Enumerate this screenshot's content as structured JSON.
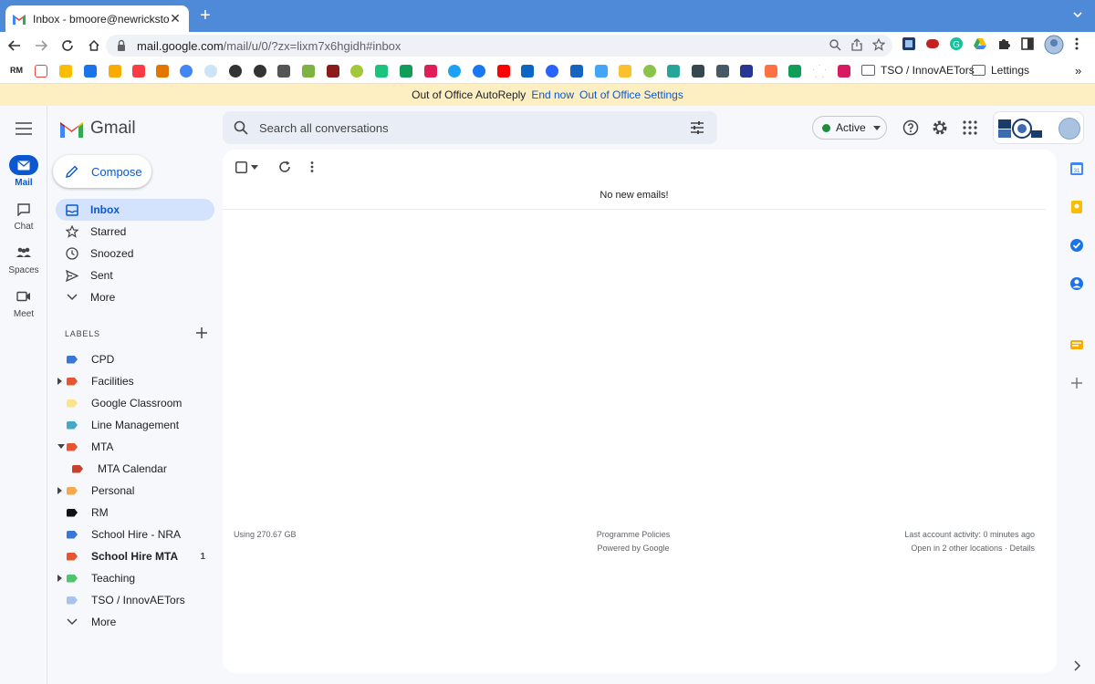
{
  "browser": {
    "tab_title": "Inbox - bmoore@newrickstone",
    "url_host": "mail.google.com",
    "url_path": "/mail/u/0/?zx=lixm7x6hgidh#inbox",
    "bookmark_folders": [
      "TSO / InnovAETors",
      "Lettings"
    ],
    "bookmark_prefix": "RM"
  },
  "ooo_banner": {
    "text": "Out of Office AutoReply",
    "end_now": "End now",
    "settings": "Out of Office Settings"
  },
  "rail": {
    "items": [
      {
        "label": "Mail"
      },
      {
        "label": "Chat"
      },
      {
        "label": "Spaces"
      },
      {
        "label": "Meet"
      }
    ]
  },
  "header": {
    "app_name": "Gmail",
    "search_placeholder": "Search all conversations",
    "status": "Active"
  },
  "compose_label": "Compose",
  "nav": {
    "items": [
      {
        "label": "Inbox"
      },
      {
        "label": "Starred"
      },
      {
        "label": "Snoozed"
      },
      {
        "label": "Sent"
      },
      {
        "label": "More"
      }
    ]
  },
  "labels": {
    "header": "LABELS",
    "items": [
      {
        "label": "CPD",
        "color": "#3a76d8"
      },
      {
        "label": "Facilities",
        "color": "#e8542d"
      },
      {
        "label": "Google Classroom",
        "color": "#fce48b"
      },
      {
        "label": "Line Management",
        "color": "#44a8c6"
      },
      {
        "label": "MTA",
        "color": "#e8542d"
      },
      {
        "label": "MTA Calendar",
        "color": "#c9412e"
      },
      {
        "label": "Personal",
        "color": "#f6a84a"
      },
      {
        "label": "RM",
        "color": "#111111"
      },
      {
        "label": "School Hire - NRA",
        "color": "#3a76d8"
      },
      {
        "label": "School Hire MTA",
        "color": "#e8542d",
        "count": "1"
      },
      {
        "label": "Teaching",
        "color": "#4fc46e"
      },
      {
        "label": "TSO / InnovAETors",
        "color": "#a8c4ee"
      },
      {
        "label": "More"
      }
    ]
  },
  "main": {
    "empty_text": "No new emails!",
    "storage": "Using 270.67 GB",
    "policies": "Programme Policies",
    "powered": "Powered by Google",
    "activity": "Last account activity: 0 minutes ago",
    "open_locations": "Open in 2 other locations · Details"
  },
  "colors": {
    "accent": "#0b57d0",
    "tabbar": "#4f8ad9",
    "ooo_bg": "#feefc3"
  }
}
